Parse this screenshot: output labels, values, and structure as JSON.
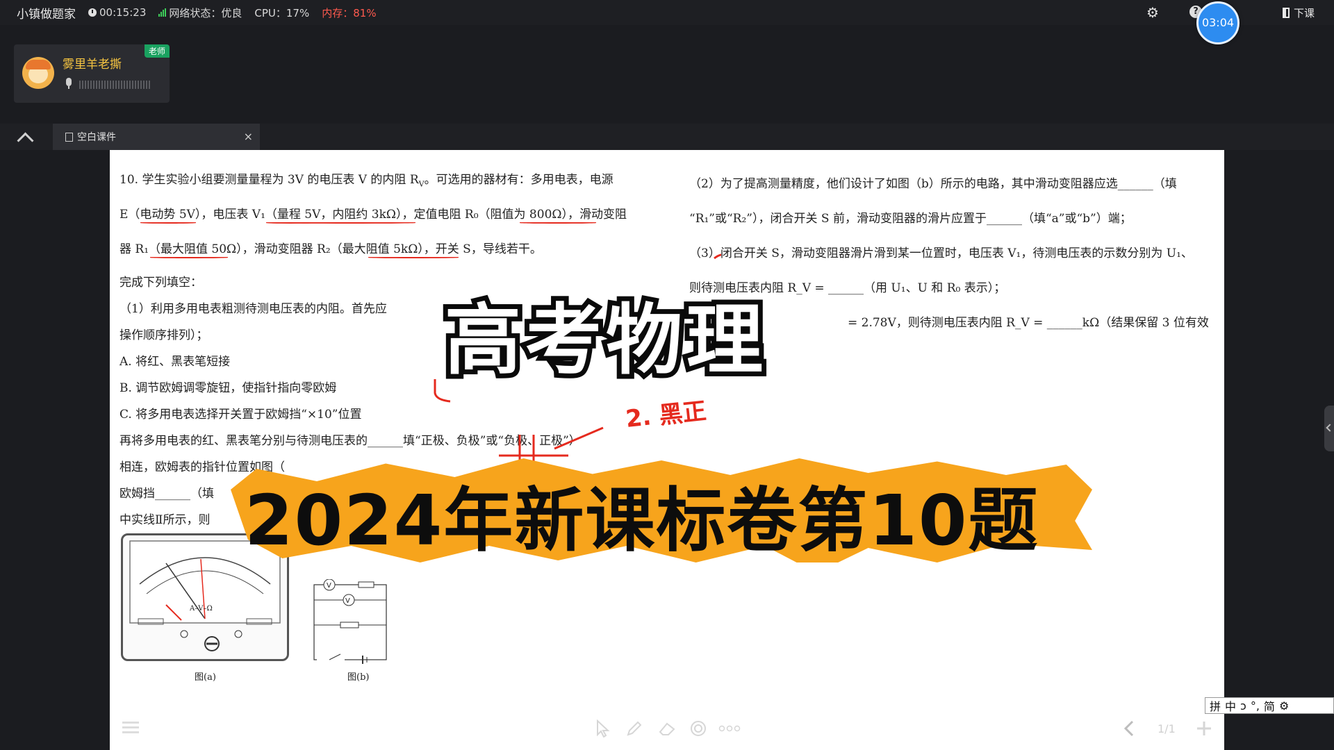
{
  "topbar": {
    "app_name": "小镇做题家",
    "time": "00:15:23",
    "network": "网络状态：优良",
    "cpu": "CPU：17%",
    "memory": "内存：81%",
    "timer": "03:04",
    "exit_label": "下课",
    "icons": [
      "clock-icon",
      "signal-icon",
      "gear-icon",
      "help-icon",
      "exit-door-icon"
    ]
  },
  "teacher": {
    "name": "雾里羊老撕",
    "role": "老师"
  },
  "tabs": [
    {
      "label": "空白课件"
    }
  ],
  "doc": {
    "q10_line1": "10. 学生实验小组要测量量程为 3V 的电压表 V 的内阻 R",
    "q10_line1_sub": "V",
    "q10_line1_tail": "。可选用的器材有：多用电表，电源",
    "q10_line2": "E（电动势 5V），电压表 V₁（量程 5V，内阻约 3kΩ），定值电阻 R₀（阻值为 800Ω），滑动变阻",
    "q10_line3": "器 R₁（最大阻值 50Ω），滑动变阻器 R₂（最大阻值 5kΩ），开关 S，导线若干。",
    "q10_line4": "完成下列填空：",
    "q10_line5": "（1）利用多用电表粗测待测电压表的内阻。首先应",
    "q10_line6": "操作顺序排列）；",
    "optA": "A. 将红、黑表笔短接",
    "optB": "B. 调节欧姆调零旋钮，使指针指向零欧姆",
    "optC": "C. 将多用电表选择开关置于欧姆挡“×10”位置",
    "line_after1": "再将多用电表的红、黑表笔分别与待测电压表的______填“正极、负极”或“负极、正极”）",
    "line_after2": "相连，欧姆表的指针位置如图（",
    "line_after3": "欧姆挡______（填",
    "line_after4": "中实线Ⅱ所示，则",
    "right1": "（2）为了提高测量精度，他们设计了如图（b）所示的电路，其中滑动变阻器应选______（填",
    "right2": "“R₁”或“R₂”），闭合开关 S 前，滑动变阻器的滑片应置于______（填“a”或“b”）端；",
    "right3": "（3）闭合开关 S，滑动变阻器滑片滑到某一位置时，电压表 V₁，待测电压表的示数分别为 U₁、",
    "right4": "则待测电压表内阻 R_V = ______（用 U₁、U 和 R₀ 表示）；",
    "right5": "= 2.78V，则待测电压表内阻 R_V = ______kΩ（结果保留 3 位有效",
    "fig_a": "图(a)",
    "fig_b": "图(b)",
    "meter_label": "A–V–Ω",
    "handwriting": "2. 黑正"
  },
  "overlay": {
    "title": "高考物理",
    "subtitle": "2024年新课标卷第10题"
  },
  "bottom_toolbar": {
    "page": "1/1",
    "icons": [
      "menu-icon",
      "pointer-icon",
      "pen-icon",
      "eraser-icon",
      "shape-icon",
      "more-icon",
      "prev-page-icon",
      "add-page-icon"
    ]
  },
  "ime": {
    "items": [
      "拼",
      "中",
      "ↄ",
      "°,",
      "简",
      "⚙"
    ]
  },
  "colors": {
    "accent_blue": "#2d8cf0",
    "teacher_name": "#f4c341",
    "memory_warn": "#ff5a4e",
    "annotation_red": "#e52a1e",
    "overlay_orange": "#f7a41c"
  }
}
